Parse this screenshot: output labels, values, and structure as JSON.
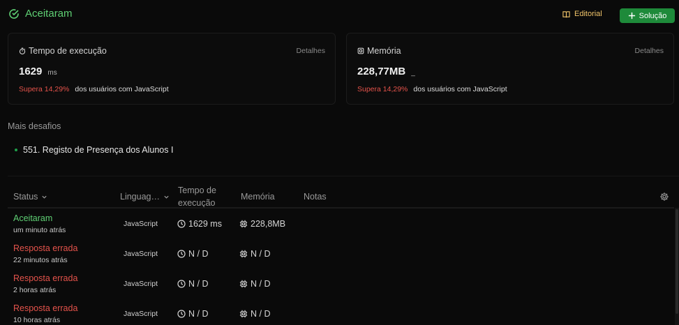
{
  "header": {
    "status": "Aceitaram",
    "editorial_label": "Editorial",
    "solution_label": "Solução"
  },
  "runtime_card": {
    "title": "Tempo de execução",
    "details_label": "Detalhes",
    "value": "1629",
    "unit": "ms",
    "beats_pct": "Supera 14,29%",
    "beats_text": "dos usuários com JavaScript"
  },
  "memory_card": {
    "title": "Memória",
    "details_label": "Detalhes",
    "value": "228,77MB",
    "unit": "_",
    "beats_pct": "Supera 14,29%",
    "beats_text": "dos usuários com JavaScript"
  },
  "more": {
    "title": "Mais desafios",
    "items": [
      "551. Registo de Presença dos Alunos I"
    ]
  },
  "table": {
    "headers": {
      "status": "Status",
      "language": "Linguag…",
      "time_line1": "Tempo de",
      "time_line2": "execução",
      "memory": "Memória",
      "notes": "Notas"
    },
    "rows": [
      {
        "status": "Aceitaram",
        "when": "um minuto atrás",
        "language": "JavaScript",
        "time": "1629 ms",
        "memory": "228,8MB"
      },
      {
        "status": "Resposta errada",
        "when": "22 minutos atrás",
        "language": "JavaScript",
        "time": "N / D",
        "memory": "N / D"
      },
      {
        "status": "Resposta errada",
        "when": "2 horas atrás",
        "language": "JavaScript",
        "time": "N / D",
        "memory": "N / D"
      },
      {
        "status": "Resposta errada",
        "when": "10 horas atrás",
        "language": "JavaScript",
        "time": "N / D",
        "memory": "N / D"
      }
    ]
  },
  "colors": {
    "accepted": "#5fd074",
    "wrong": "#e5534b",
    "editorial": "#f2c56a",
    "solution_button": "#1e8a3a",
    "background": "#0a0a0a"
  },
  "icons": {
    "status": "check-circle-icon",
    "editorial": "book-icon",
    "solution": "plus-icon",
    "runtime": "stopwatch-icon",
    "memory": "chip-icon",
    "time_cell": "clock-icon",
    "memory_cell": "cpu-icon",
    "settings": "gear-icon"
  }
}
